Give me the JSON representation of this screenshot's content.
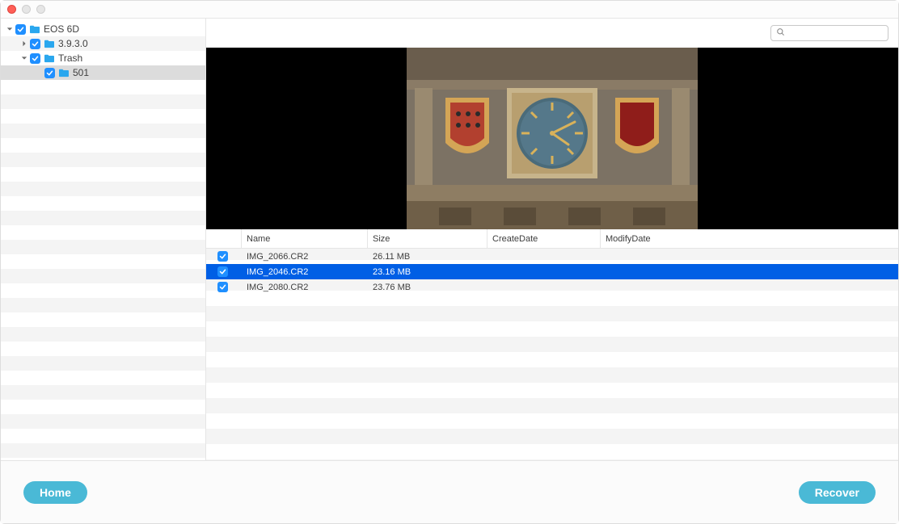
{
  "sidebar": {
    "items": [
      {
        "label": "EOS 6D",
        "indent": 6,
        "expanded": true,
        "hasChildren": true,
        "checked": true
      },
      {
        "label": "3.9.3.0",
        "indent": 24,
        "expanded": false,
        "hasChildren": true,
        "checked": true
      },
      {
        "label": "Trash",
        "indent": 24,
        "expanded": true,
        "hasChildren": true,
        "checked": true
      },
      {
        "label": "501",
        "indent": 42,
        "expanded": false,
        "hasChildren": false,
        "checked": true,
        "selected": true
      }
    ]
  },
  "search": {
    "placeholder": ""
  },
  "table": {
    "headers": {
      "name": "Name",
      "size": "Size",
      "create": "CreateDate",
      "modify": "ModifyDate"
    },
    "rows": [
      {
        "name": "IMG_2066.CR2",
        "size": "26.11 MB",
        "create": "",
        "modify": "",
        "checked": true,
        "selected": false
      },
      {
        "name": "IMG_2046.CR2",
        "size": "23.16 MB",
        "create": "",
        "modify": "",
        "checked": true,
        "selected": true
      },
      {
        "name": "IMG_2080.CR2",
        "size": "23.76 MB",
        "create": "",
        "modify": "",
        "checked": true,
        "selected": false
      }
    ]
  },
  "footer": {
    "home": "Home",
    "recover": "Recover"
  }
}
